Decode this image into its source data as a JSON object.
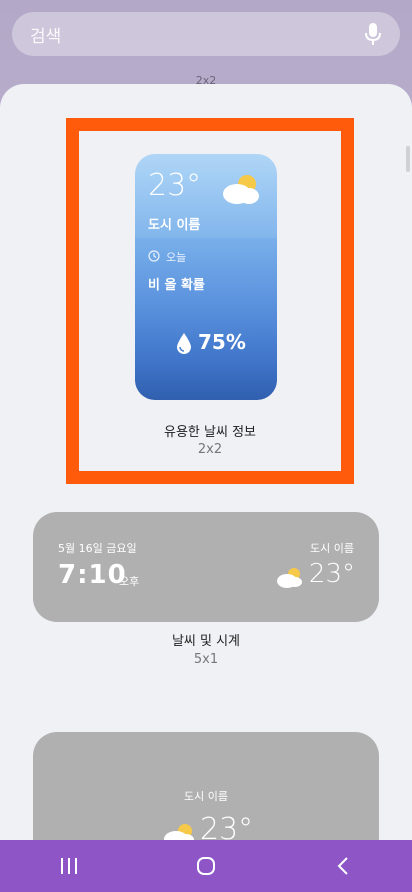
{
  "search": {
    "placeholder": "검색"
  },
  "top_peek_label": "2x2",
  "widgets": [
    {
      "title": "유용한 날씨 정보",
      "size": "2x2",
      "temperature": "23°",
      "city": "도시 이름",
      "today_label": "오늘",
      "rain_label": "비 올 확률",
      "rain_percent": "75%"
    },
    {
      "title": "날씨 및 시계",
      "size": "5x1",
      "date": "5월 16일 금요일",
      "time": "7:10",
      "ampm": "오후",
      "city": "도시 이름",
      "temperature": "23°"
    },
    {
      "city": "도시 이름",
      "temperature": "23°"
    }
  ],
  "colors": {
    "selection_border": "#ff5b0a",
    "nav_bar": "#8d55c6",
    "card_gray": "#b0b0b0"
  },
  "icons": {
    "mic": "mic-icon",
    "cloud_sun": "cloud-sun-icon",
    "clock": "clock-icon",
    "raindrop": "raindrop-icon",
    "recents": "recents-icon",
    "home": "home-icon",
    "back": "back-icon"
  }
}
